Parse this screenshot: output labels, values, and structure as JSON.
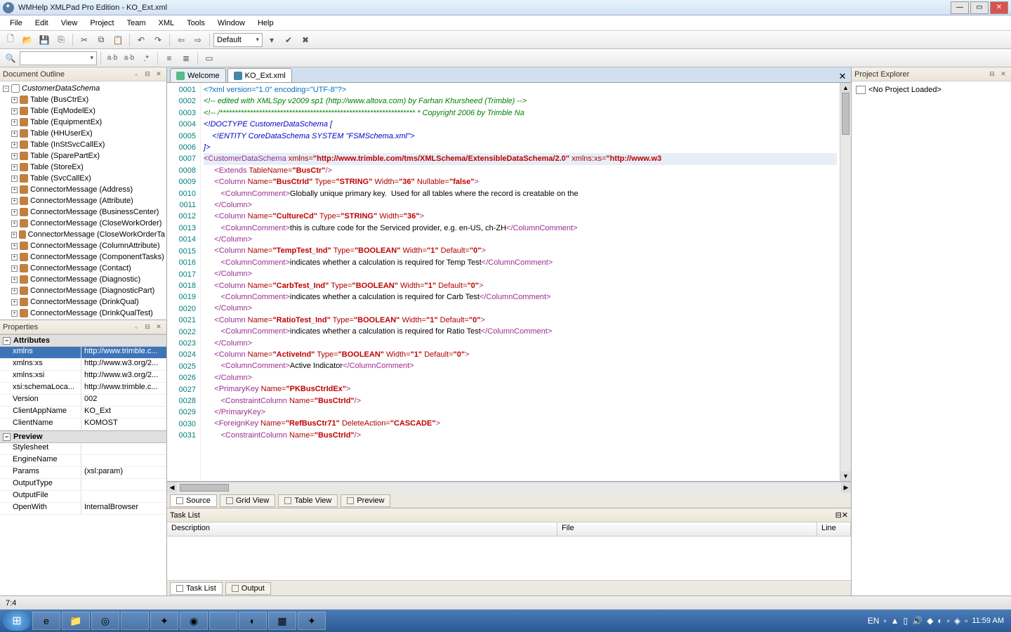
{
  "window": {
    "title": "WMHelp XMLPad Pro Edition - KO_Ext.xml"
  },
  "menu": {
    "file": "File",
    "edit": "Edit",
    "view": "View",
    "project": "Project",
    "team": "Team",
    "xml": "XML",
    "tools": "Tools",
    "window": "Window",
    "help": "Help"
  },
  "toolbar": {
    "combo_default": "Default"
  },
  "outline": {
    "title": "Document Outline",
    "root": "CustomerDataSchema",
    "items": [
      "Table (BusCtrEx)",
      "Table (EqModelEx)",
      "Table (EquipmentEx)",
      "Table (HHUserEx)",
      "Table (InStSvcCallEx)",
      "Table (SparePartEx)",
      "Table (StoreEx)",
      "Table (SvcCallEx)",
      "ConnectorMessage (Address)",
      "ConnectorMessage (Attribute)",
      "ConnectorMessage (BusinessCenter)",
      "ConnectorMessage (CloseWorkOrder)",
      "ConnectorMessage (CloseWorkOrderTa",
      "ConnectorMessage (ColumnAttribute)",
      "ConnectorMessage (ComponentTasks)",
      "ConnectorMessage (Contact)",
      "ConnectorMessage (Diagnostic)",
      "ConnectorMessage (DiagnosticPart)",
      "ConnectorMessage (DrinkQual)",
      "ConnectorMessage (DrinkQualTest)"
    ]
  },
  "properties": {
    "title": "Properties",
    "attributes_hdr": "Attributes",
    "preview_hdr": "Preview",
    "attrs": [
      {
        "n": "xmlns",
        "v": "http://www.trimble.c..."
      },
      {
        "n": "xmlns:xs",
        "v": "http://www.w3.org/2..."
      },
      {
        "n": "xmlns:xsi",
        "v": "http://www.w3.org/2..."
      },
      {
        "n": "xsi:schemaLoca...",
        "v": "http://www.trimble.c..."
      },
      {
        "n": "Version",
        "v": "002"
      },
      {
        "n": "ClientAppName",
        "v": "KO_Ext"
      },
      {
        "n": "ClientName",
        "v": "KOMOST"
      }
    ],
    "preview": [
      {
        "n": "Stylesheet",
        "v": ""
      },
      {
        "n": "EngineName",
        "v": ""
      },
      {
        "n": "Params",
        "v": "(xsl:param)"
      },
      {
        "n": "OutputType",
        "v": ""
      },
      {
        "n": "OutputFile",
        "v": ""
      },
      {
        "n": "OpenWith",
        "v": "InternalBrowser"
      }
    ]
  },
  "tabs": {
    "welcome": "Welcome",
    "file": "KO_Ext.xml"
  },
  "viewtabs": {
    "source": "Source",
    "grid": "Grid View",
    "table": "Table View",
    "preview": "Preview"
  },
  "tasklist": {
    "title": "Task List",
    "col_desc": "Description",
    "col_file": "File",
    "col_line": "Line",
    "tab_task": "Task List",
    "tab_output": "Output"
  },
  "projexp": {
    "title": "Project Explorer",
    "no_project": "<No Project Loaded>"
  },
  "status": {
    "pos": "7:4"
  },
  "tray": {
    "lang": "EN",
    "time": "11:59 AM"
  },
  "gutter": [
    "0001",
    "0002",
    "0003",
    "0004",
    "0005",
    "0006",
    "0007",
    "0008",
    "0009",
    "0010",
    "0011",
    "0012",
    "0013",
    "0014",
    "0015",
    "0016",
    "0017",
    "0018",
    "0019",
    "0020",
    "0021",
    "0022",
    "0023",
    "0024",
    "0025",
    "0026",
    "0027",
    "0028",
    "0029",
    "0030",
    "0031"
  ]
}
